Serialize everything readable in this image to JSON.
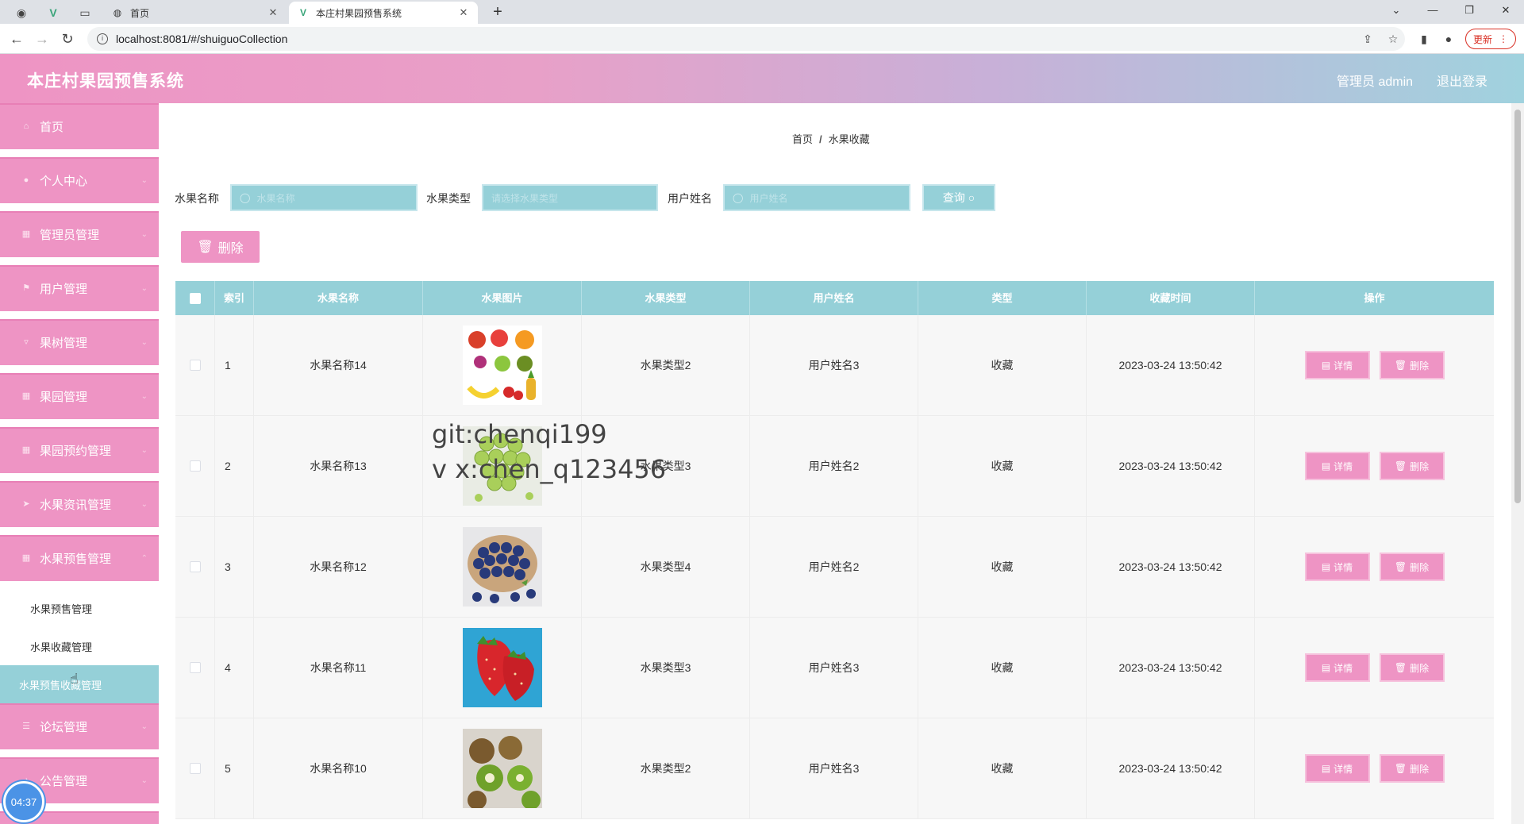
{
  "browser": {
    "tabs": [
      {
        "title": "首页",
        "active": false
      },
      {
        "title": "本庄村果园预售系统",
        "active": true
      }
    ],
    "url": "localhost:8081/#/shuiguoCollection",
    "update_label": "更新"
  },
  "header": {
    "title": "本庄村果园预售系统",
    "user": "管理员 admin",
    "logout": "退出登录"
  },
  "sidebar": {
    "items": [
      {
        "label": "首页",
        "icon": "home-icon"
      },
      {
        "label": "个人中心",
        "icon": "person-icon"
      },
      {
        "label": "管理员管理",
        "icon": "grid-icon"
      },
      {
        "label": "用户管理",
        "icon": "flag-icon"
      },
      {
        "label": "果树管理",
        "icon": "cup-icon"
      },
      {
        "label": "果园管理",
        "icon": "grid-icon"
      },
      {
        "label": "果园预约管理",
        "icon": "grid-icon"
      },
      {
        "label": "水果资讯管理",
        "icon": "send-icon"
      },
      {
        "label": "水果预售管理",
        "icon": "grid-icon"
      },
      {
        "label": "论坛管理",
        "icon": "menu-icon"
      },
      {
        "label": "公告管理",
        "icon": "bell-icon"
      }
    ],
    "submenu": [
      {
        "label": "水果预售管理",
        "active": false
      },
      {
        "label": "水果收藏管理",
        "active": false
      },
      {
        "label": "水果预售收藏管理",
        "active": true
      }
    ],
    "timer": "04:37"
  },
  "breadcrumb": {
    "home": "首页",
    "sep": "/",
    "current": "水果收藏"
  },
  "search": {
    "fields": [
      {
        "label": "水果名称",
        "placeholder": "水果名称"
      },
      {
        "label": "水果类型",
        "placeholder": "请选择水果类型"
      },
      {
        "label": "用户姓名",
        "placeholder": "用户姓名"
      }
    ],
    "query_label": "查询"
  },
  "toolbar": {
    "delete_label": "删除"
  },
  "table": {
    "columns": [
      "索引",
      "水果名称",
      "水果图片",
      "水果类型",
      "用户姓名",
      "类型",
      "收藏时间",
      "操作"
    ],
    "rows": [
      {
        "index": "1",
        "name": "水果名称14",
        "image": "mixed-fruits",
        "type": "水果类型2",
        "user": "用户姓名3",
        "kind": "收藏",
        "time": "2023-03-24 13:50:42"
      },
      {
        "index": "2",
        "name": "水果名称13",
        "image": "green-grapes",
        "type": "水果类型3",
        "user": "用户姓名2",
        "kind": "收藏",
        "time": "2023-03-24 13:50:42"
      },
      {
        "index": "3",
        "name": "水果名称12",
        "image": "blueberries",
        "type": "水果类型4",
        "user": "用户姓名2",
        "kind": "收藏",
        "time": "2023-03-24 13:50:42"
      },
      {
        "index": "4",
        "name": "水果名称11",
        "image": "strawberries",
        "type": "水果类型3",
        "user": "用户姓名3",
        "kind": "收藏",
        "time": "2023-03-24 13:50:42"
      },
      {
        "index": "5",
        "name": "水果名称10",
        "image": "kiwis",
        "type": "水果类型2",
        "user": "用户姓名3",
        "kind": "收藏",
        "time": "2023-03-24 13:50:42"
      }
    ],
    "detail_label": "详情",
    "delete_label": "删除"
  },
  "watermark": {
    "line1": "git:chenqi199",
    "line2": "v x:chen_q123456"
  },
  "colors": {
    "pink": "#ee94c4",
    "teal": "#95d0d8"
  }
}
